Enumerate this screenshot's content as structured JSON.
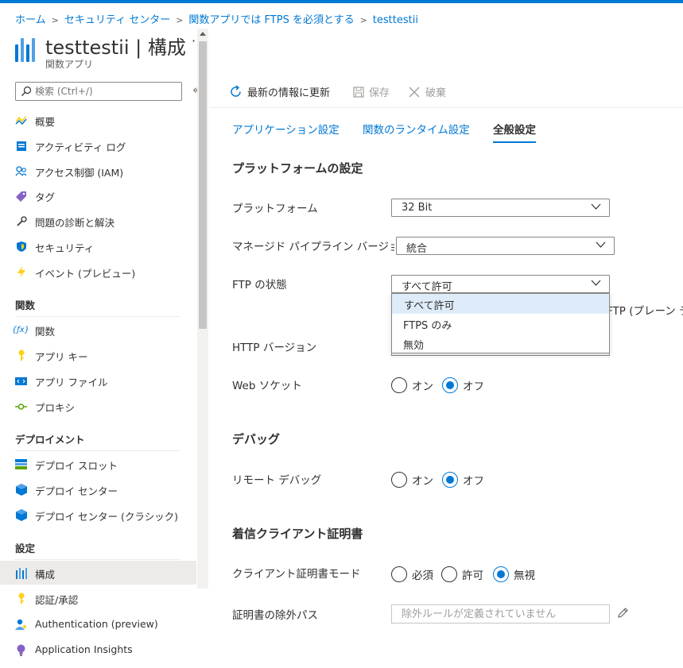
{
  "colors": {
    "accent": "#0078d4",
    "selected_menu": "#deecf9",
    "active_nav": "#edebe9"
  },
  "breadcrumb": [
    "ホーム",
    "セキュリティ センター",
    "関数アプリでは FTPS を必須とする",
    "testtestii"
  ],
  "header": {
    "title": "testtestii | 構成",
    "subtitle": "関数アプリ",
    "more": "···"
  },
  "search": {
    "placeholder": "検索 (Ctrl+/)"
  },
  "sidebar": {
    "collapse": "«",
    "top_items": [
      {
        "label": "概要",
        "icon": "lightning-bolt-icon"
      },
      {
        "label": "アクティビティ ログ",
        "icon": "activity-log-icon"
      },
      {
        "label": "アクセス制御 (IAM)",
        "icon": "people-icon"
      },
      {
        "label": "タグ",
        "icon": "tag-icon"
      },
      {
        "label": "問題の診断と解決",
        "icon": "wrench-icon"
      },
      {
        "label": "セキュリティ",
        "icon": "shield-icon"
      },
      {
        "label": "イベント (プレビュー)",
        "icon": "lightning-icon"
      }
    ],
    "functions_header": "関数",
    "functions_items": [
      {
        "label": "関数",
        "icon": "function-icon"
      },
      {
        "label": "アプリ キー",
        "icon": "key-icon"
      },
      {
        "label": "アプリ ファイル",
        "icon": "code-file-icon"
      },
      {
        "label": "プロキシ",
        "icon": "proxy-icon"
      }
    ],
    "deploy_header": "デプロイメント",
    "deploy_items": [
      {
        "label": "デプロイ スロット",
        "icon": "slots-icon"
      },
      {
        "label": "デプロイ センター",
        "icon": "cube-icon"
      },
      {
        "label": "デプロイ センター (クラシック)",
        "icon": "cube-icon"
      }
    ],
    "settings_header": "設定",
    "settings_items": [
      {
        "label": "構成",
        "icon": "sliders-icon",
        "active": true
      },
      {
        "label": "認証/承認",
        "icon": "key-icon"
      },
      {
        "label": "Authentication (preview)",
        "icon": "person-key-icon"
      },
      {
        "label": "Application Insights",
        "icon": "bulb-icon"
      }
    ]
  },
  "toolbar": {
    "refresh": "最新の情報に更新",
    "save": "保存",
    "discard": "破棄"
  },
  "tabs": [
    "アプリケーション設定",
    "関数のランタイム設定",
    "全般設定"
  ],
  "platform": {
    "section_title": "プラットフォームの設定",
    "platform_label": "プラットフォーム",
    "platform_value": "32 Bit",
    "pipeline_label": "マネージド パイプライン バージョン",
    "pipeline_value": "統合",
    "ftp_label": "FTP の状態",
    "ftp_value": "すべて許可",
    "ftp_options": [
      "すべて許可",
      "FTPS のみ",
      "無効"
    ],
    "ftp_hint_fragment": "FTP (プレーン テ",
    "http_label": "HTTP バージョン",
    "web_socket_label": "Web ソケット",
    "on": "オン",
    "off": "オフ"
  },
  "debug": {
    "section_title": "デバッグ",
    "remote_label": "リモート デバッグ",
    "on": "オン",
    "off": "オフ"
  },
  "client_cert": {
    "section_title": "着信クライアント証明書",
    "mode_label": "クライアント証明書モード",
    "options": [
      "必須",
      "許可",
      "無視"
    ],
    "exclusion_label": "証明書の除外パス",
    "exclusion_placeholder": "除外ルールが定義されていません"
  }
}
